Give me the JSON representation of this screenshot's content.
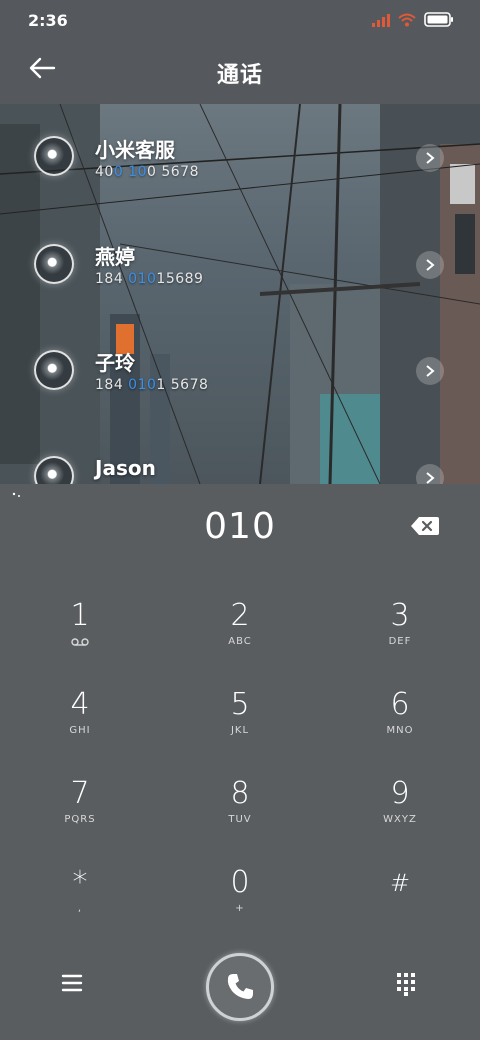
{
  "status": {
    "time": "2:36",
    "signal_color": "#e05a3a",
    "wifi_color": "#e05a3a"
  },
  "header": {
    "title": "通话",
    "back_icon": "arrow-left-icon"
  },
  "results": [
    {
      "name": "小米客服",
      "number_parts": [
        "40",
        "0 10",
        "0 5678"
      ]
    },
    {
      "name": "燕婷",
      "number_parts": [
        "184 ",
        "010",
        "15689"
      ]
    },
    {
      "name": "子玲",
      "number_parts": [
        "184 ",
        "010",
        "1 5678"
      ]
    },
    {
      "name": "Jason",
      "number_parts": [
        "",
        "",
        ""
      ]
    }
  ],
  "dialer": {
    "input": "010",
    "backspace_icon": "backspace-icon"
  },
  "keypad": [
    {
      "digit": "1",
      "letters": ""
    },
    {
      "digit": "2",
      "letters": "ABC"
    },
    {
      "digit": "3",
      "letters": "DEF"
    },
    {
      "digit": "4",
      "letters": "GHI"
    },
    {
      "digit": "5",
      "letters": "JKL"
    },
    {
      "digit": "6",
      "letters": "MNO"
    },
    {
      "digit": "7",
      "letters": "PQRS"
    },
    {
      "digit": "8",
      "letters": "TUV"
    },
    {
      "digit": "9",
      "letters": "WXYZ"
    },
    {
      "digit": "*",
      "letters": ","
    },
    {
      "digit": "0",
      "letters": "+"
    },
    {
      "digit": "#",
      "letters": ""
    }
  ],
  "colors": {
    "highlight": "#3a8fe8",
    "background": "#5a5d60"
  },
  "icons": {
    "menu": "hamburger-menu-icon",
    "call": "phone-icon",
    "dialpad": "dialpad-icon"
  }
}
